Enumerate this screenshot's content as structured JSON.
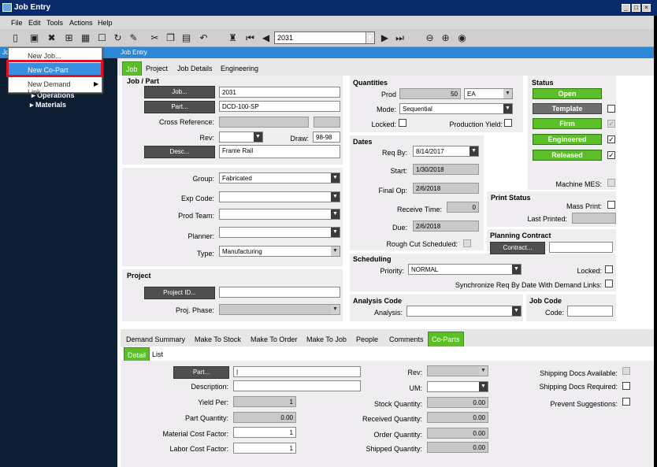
{
  "window": {
    "title": "Job Entry"
  },
  "menu": [
    "File",
    "Edit",
    "Tools",
    "Actions",
    "Help"
  ],
  "toolbar": {
    "job_value": "2031"
  },
  "left": {
    "header": "Jo",
    "popup": [
      "New Job...",
      "New Co-Part",
      "New Demand Link"
    ],
    "tree": [
      "Operations",
      "Materials"
    ]
  },
  "job_entry_header": "Job Entry",
  "top_tabs": [
    "Job",
    "Project",
    "Job Details",
    "Engineering"
  ],
  "job_part": {
    "title": "Job / Part",
    "job_btn": "Job...",
    "job_value": "2031",
    "part_btn": "Part...",
    "part_value": "DCD-100-SP",
    "cross_ref_label": "Cross Reference:",
    "rev_label": "Rev:",
    "draw_label": "Draw:",
    "draw_value": "98-98",
    "desc_btn": "Desc...",
    "desc_value": "Frame Rail"
  },
  "classification": {
    "group_label": "Group:",
    "group_value": "Fabricated",
    "exp_label": "Exp Code:",
    "prod_team_label": "Prod Team:",
    "planner_label": "Planner:",
    "type_label": "Type:",
    "type_value": "Manufacturing"
  },
  "project": {
    "title": "Project",
    "project_btn": "Project ID...",
    "phase_label": "Proj. Phase:"
  },
  "quantities": {
    "title": "Quantities",
    "prod_label": "Prod",
    "prod_value": "50",
    "uom": "EA",
    "mode_label": "Mode:",
    "mode_value": "Sequential",
    "locked_label": "Locked:",
    "prod_yield_label": "Production Yield:"
  },
  "dates": {
    "title": "Dates",
    "req_by_label": "Req By:",
    "req_by_value": "8/14/2017",
    "start_label": "Start:",
    "start_value": "1/30/2018",
    "final_op_label": "Final Op:",
    "final_op_value": "2/6/2018",
    "receive_label": "Receive Time:",
    "receive_value": "0",
    "due_label": "Due:",
    "due_value": "2/6/2018",
    "rough_cut_label": "Rough Cut Scheduled:"
  },
  "scheduling": {
    "title": "Scheduling",
    "priority_label": "Priority:",
    "priority_value": "NORMAL",
    "locked_label": "Locked:",
    "sync_label": "Synchronize Req By Date With Demand Links:"
  },
  "analysis": {
    "title": "Analysis Code",
    "label": "Analysis:"
  },
  "status": {
    "title": "Status",
    "open": "Open",
    "template": "Template",
    "firm": "Firm",
    "engineered": "Engineered",
    "released": "Released",
    "machine_mes": "Machine MES:"
  },
  "print_status": {
    "title": "Print Status",
    "mass_print": "Mass Print:",
    "last_printed": "Last Printed:"
  },
  "planning_contract": {
    "title": "Planning Contract",
    "btn": "Contract..."
  },
  "job_code": {
    "title": "Job Code",
    "label": "Code:"
  },
  "sub_tabs": [
    "Demand Summary",
    "Make To Stock",
    "Make To Order",
    "Make To Job",
    "People",
    "Comments",
    "Co-Parts"
  ],
  "detail_tabs": [
    "Detail",
    "List"
  ],
  "coparts": {
    "part_btn": "Part...",
    "part_value": "|",
    "description_label": "Description:",
    "yield_per_label": "Yield Per:",
    "yield_per_value": "1",
    "part_qty_label": "Part Quantity:",
    "part_qty_value": "0.00",
    "mat_cost_label": "Material Cost Factor:",
    "mat_cost_value": "1",
    "labor_cost_label": "Labor Cost Factor:",
    "labor_cost_value": "1",
    "rev_label": "Rev:",
    "um_label": "UM:",
    "stock_qty_label": "Stock Quantity:",
    "stock_qty_value": "0.00",
    "received_qty_label": "Received Quantity:",
    "received_qty_value": "0.00",
    "order_qty_label": "Order Quantity:",
    "order_qty_value": "0.00",
    "shipped_qty_label": "Shipped Quantity:",
    "shipped_qty_value": "0.00",
    "ship_avail_label": "Shipping Docs Available:",
    "ship_req_label": "Shipping Docs Required:",
    "prevent_label": "Prevent Suggestions:"
  }
}
